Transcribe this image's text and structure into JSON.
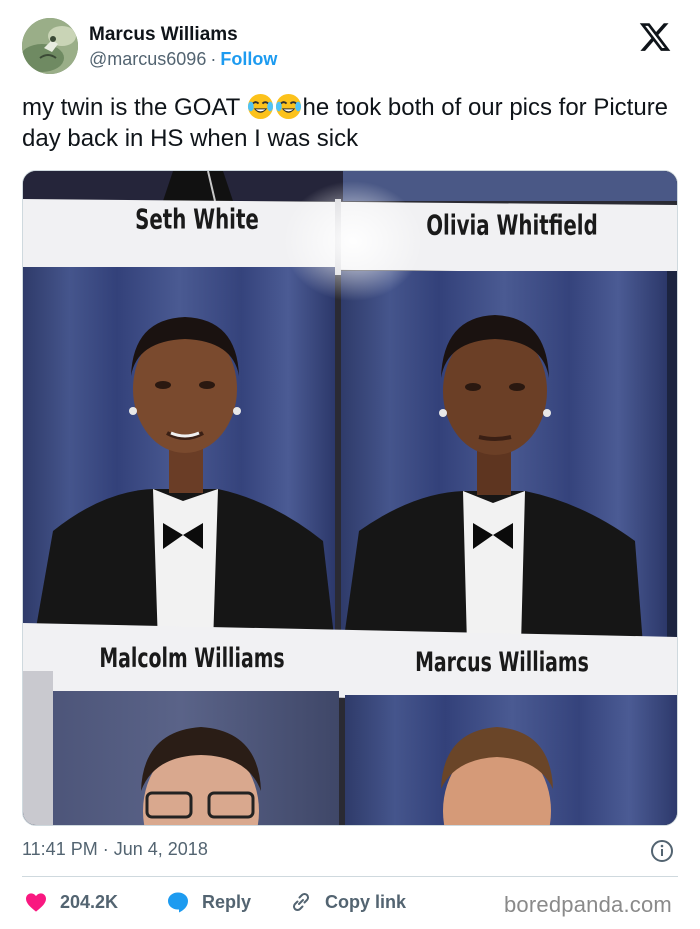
{
  "author": {
    "name": "Marcus Williams",
    "handle": "@marcus6096",
    "separator": "·",
    "follow_label": "Follow"
  },
  "tweet": {
    "text_part1": "my twin is the GOAT ",
    "text_part2": "he took both of our pics for Picture day back in HS when I was sick",
    "emoji": [
      "face-with-tears-of-joy",
      "face-with-tears-of-joy"
    ]
  },
  "media": {
    "labels": {
      "top_left": "Seth White",
      "top_right": "Olivia Whitfield",
      "bottom_left": "Malcolm Williams",
      "bottom_right": "Marcus Williams"
    }
  },
  "timestamp": {
    "time": "11:41 PM",
    "separator": "·",
    "date": "Jun 4, 2018"
  },
  "actions": {
    "likes": "204.2K",
    "reply_label": "Reply",
    "copy_link_label": "Copy link"
  },
  "watermark": "boredpanda.com",
  "colors": {
    "accent": "#1d9bf0",
    "like": "#f91880",
    "text": "#0f1419",
    "secondary": "#536471"
  },
  "icons": [
    "x-logo",
    "info-icon",
    "heart-icon",
    "reply-bubble-icon",
    "link-icon"
  ]
}
